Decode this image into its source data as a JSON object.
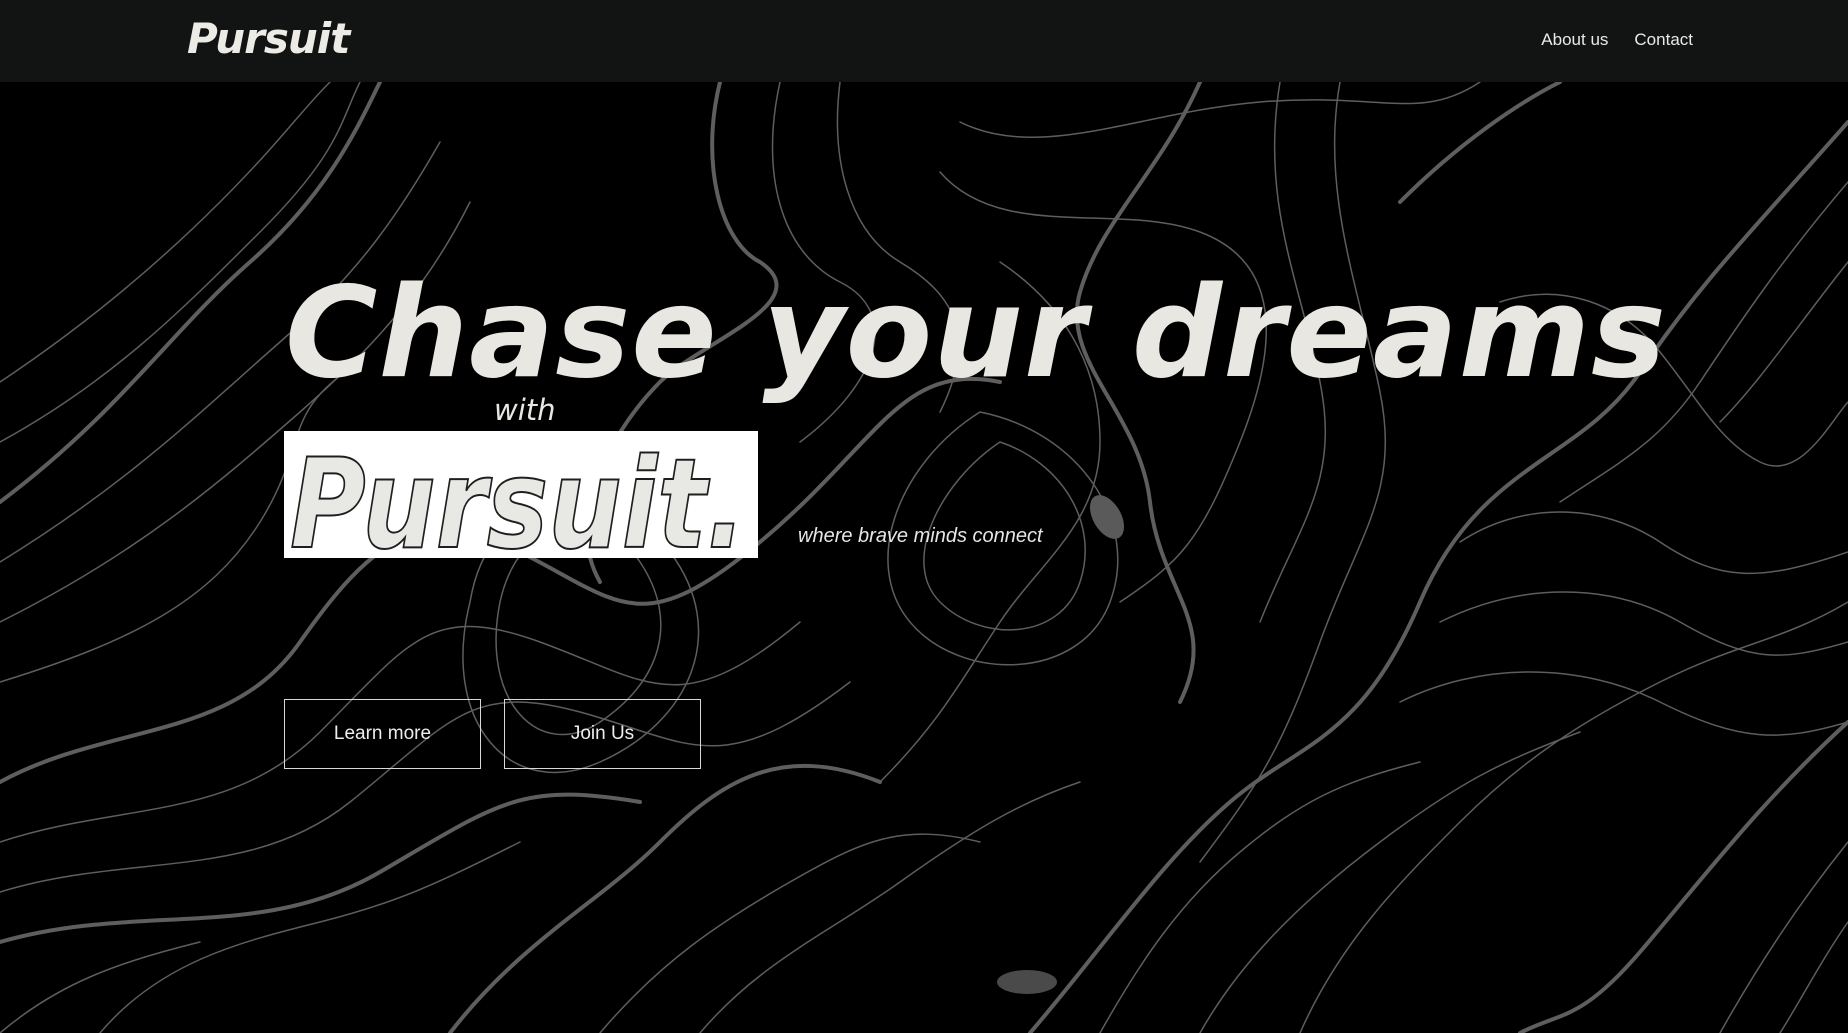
{
  "header": {
    "brand": "Pursuit",
    "nav": [
      {
        "label": "About us"
      },
      {
        "label": "Contact"
      }
    ]
  },
  "hero": {
    "title": "Chase your dreams",
    "with": "with",
    "brand_mark": "Pursuit.",
    "tagline": "where brave minds connect",
    "buttons": {
      "learn_more": "Learn more",
      "join_us": "Join Us"
    }
  },
  "background": {
    "pattern": "topographic-contour-lines",
    "base_color": "#000000",
    "line_color": "#6b6b6b"
  }
}
